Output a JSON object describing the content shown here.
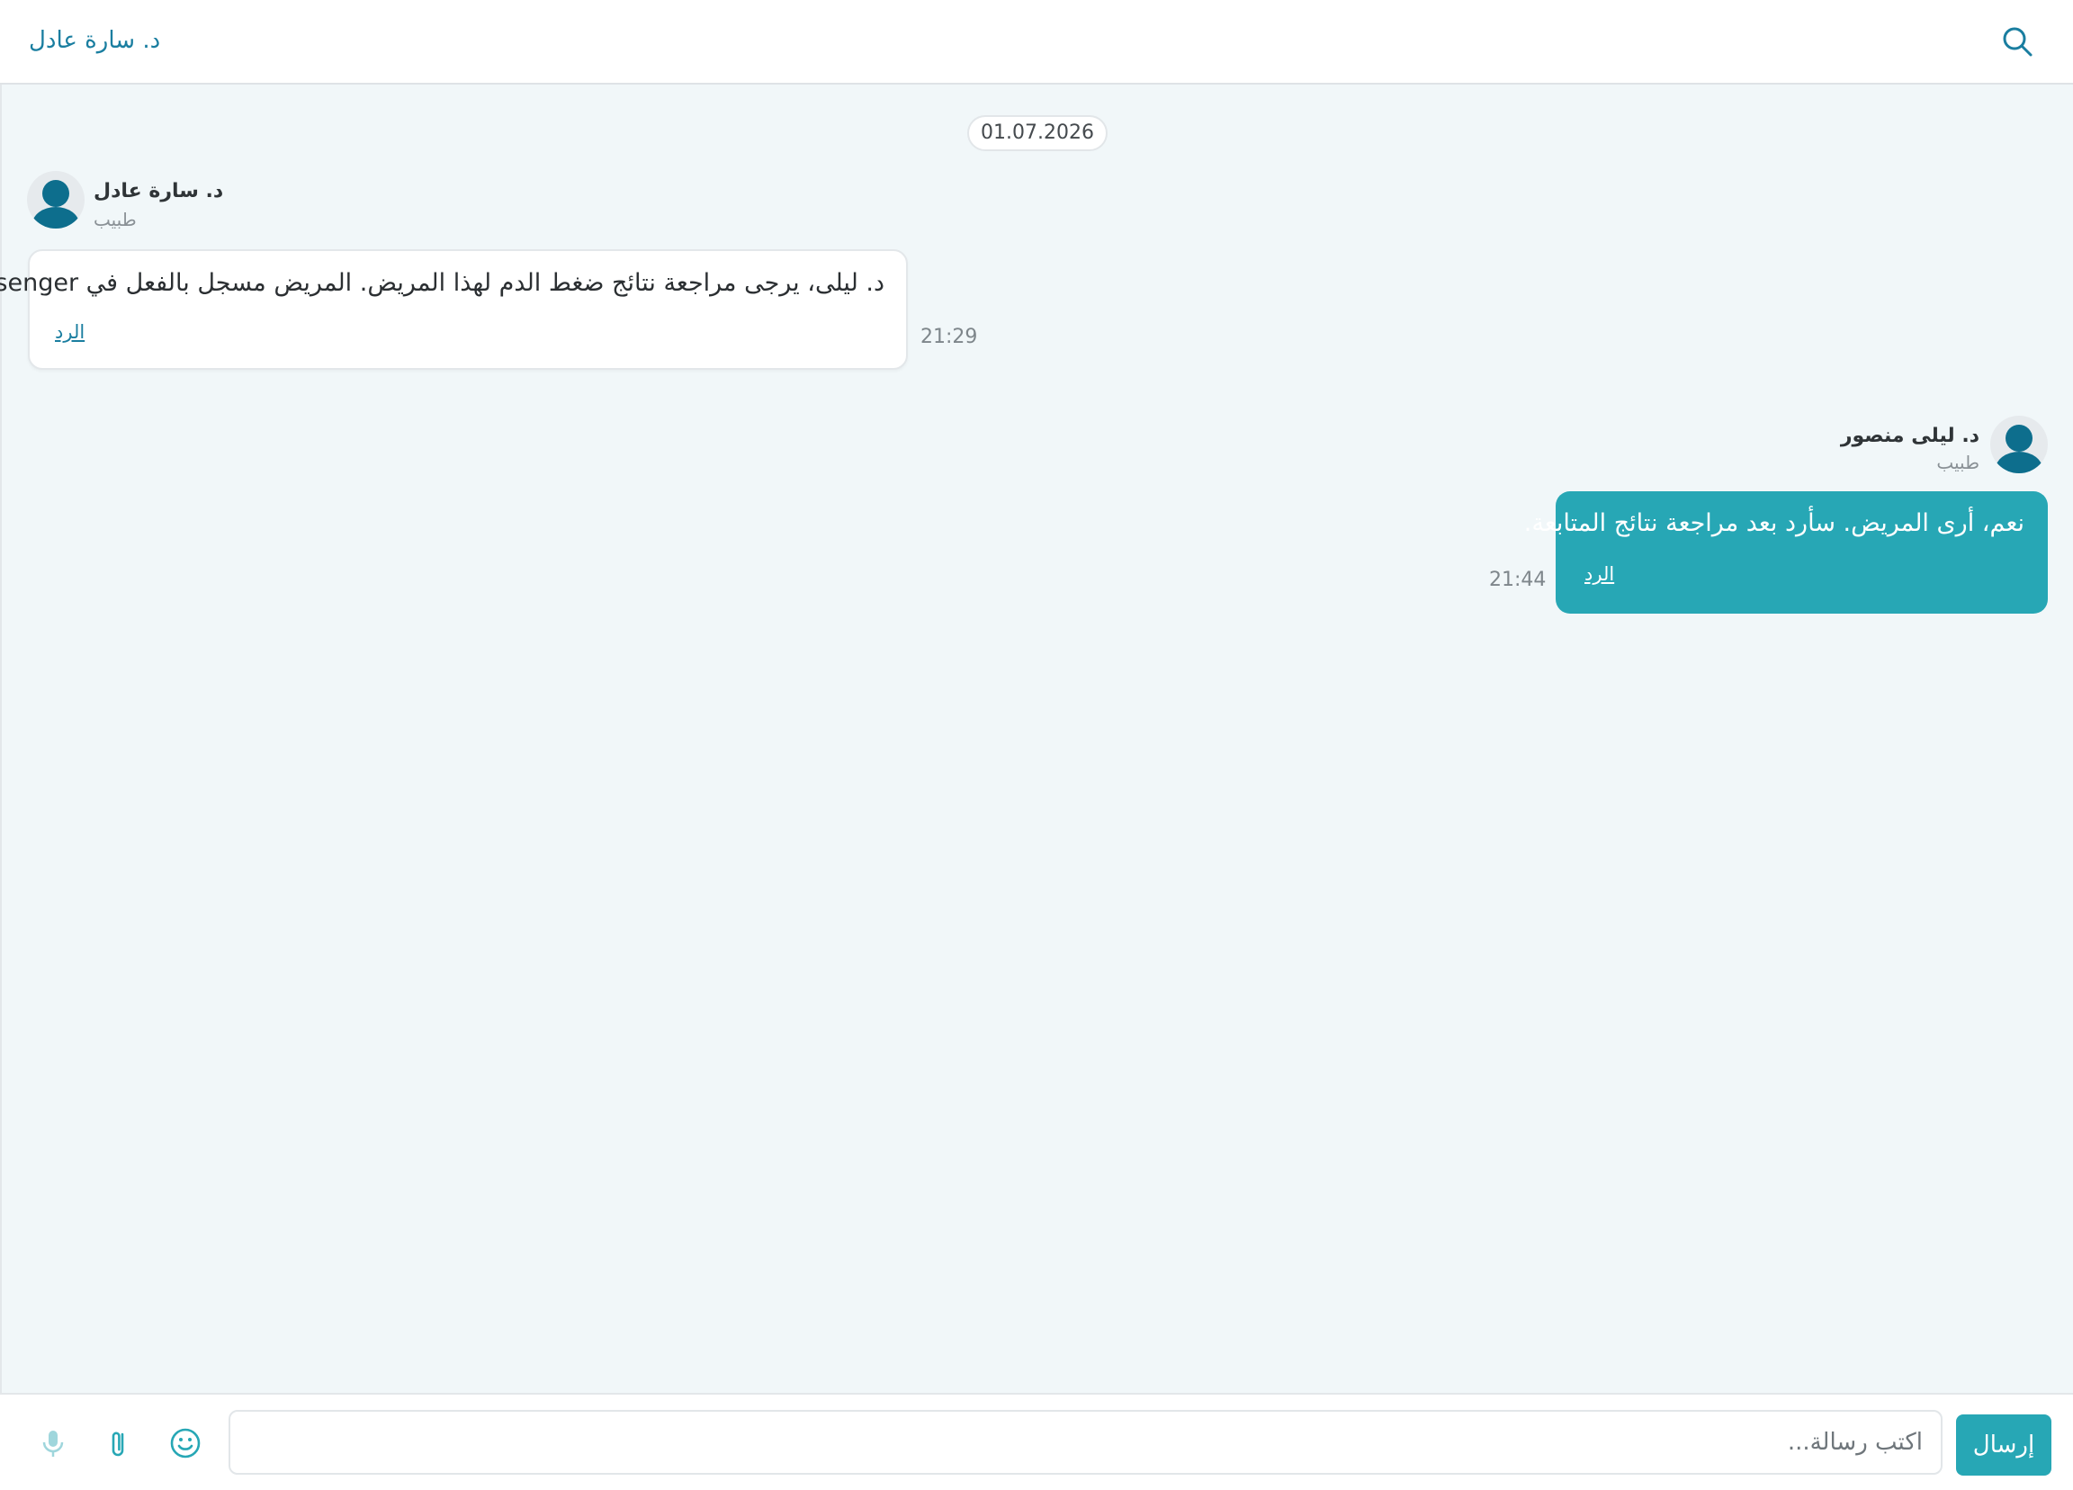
{
  "header": {
    "title": "د. سارة عادل",
    "search_icon": "search-icon"
  },
  "date_separator": "01.07.2026",
  "messages": [
    {
      "sender": "د. سارة عادل",
      "role": "طبيب",
      "text": "د. ليلى، يرجى مراجعة نتائج ضغط الدم لهذا المريض. المريض مسجل بالفعل في Medsenger.",
      "time": "21:29",
      "reply_label": "الرد",
      "direction": "incoming"
    },
    {
      "sender": "د. ليلى منصور",
      "role": "طبيب",
      "text": "نعم، أرى المريض. سأرد بعد مراجعة نتائج المتابعة.",
      "time": "21:44",
      "reply_label": "الرد",
      "direction": "outgoing"
    }
  ],
  "composer": {
    "placeholder": "اكتب رسالة...",
    "send_label": "إرسال",
    "icons": [
      "microphone-icon",
      "paperclip-icon",
      "emoji-icon"
    ]
  },
  "colors": {
    "accent": "#27a7b5",
    "title_blue": "#1a7ea0",
    "avatar": "#0d6e8d",
    "background": "#f1f7f9"
  }
}
